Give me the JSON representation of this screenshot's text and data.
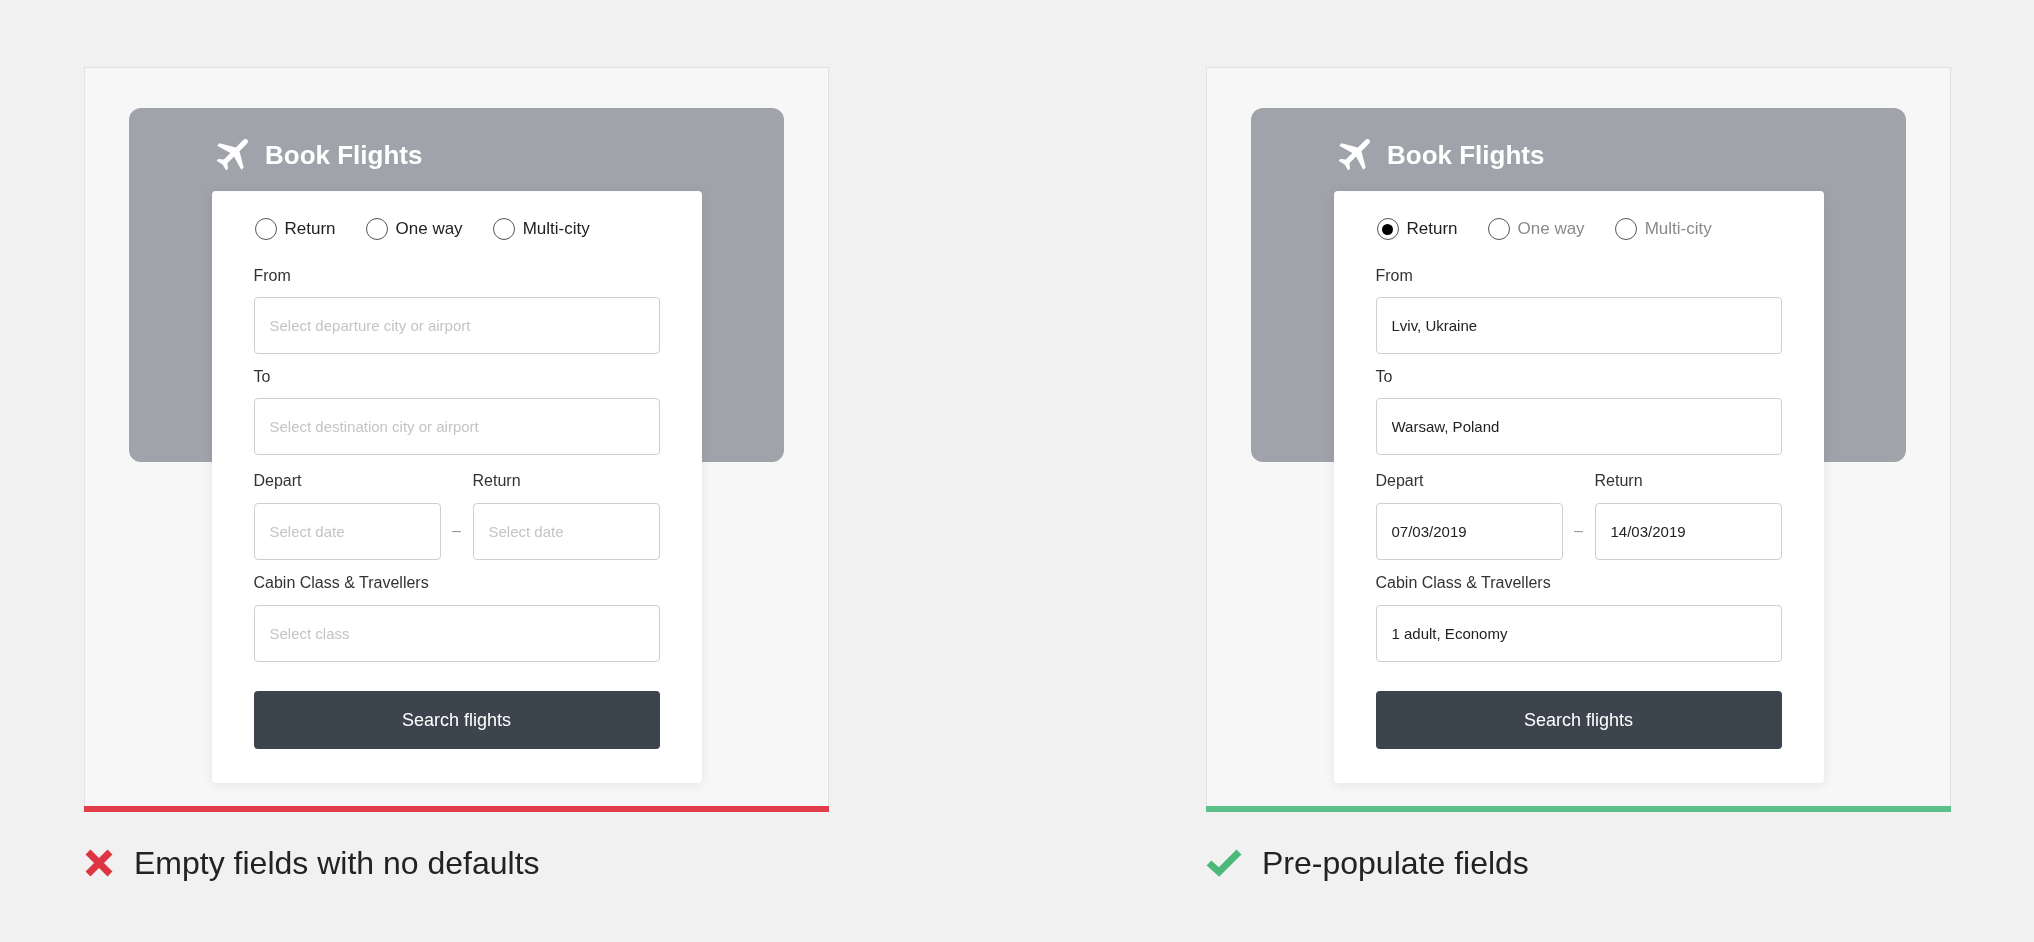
{
  "examples": [
    {
      "kind": "bad",
      "color": "#e03c4a",
      "caption": "Empty fields with no defaults",
      "form": {
        "title": "Book Flights",
        "trip_types": [
          {
            "label": "Return",
            "selected": false
          },
          {
            "label": "One way",
            "selected": false
          },
          {
            "label": "Multi-city",
            "selected": false
          }
        ],
        "from": {
          "label": "From",
          "placeholder": "Select departure city or airport"
        },
        "to": {
          "label": "To",
          "placeholder": "Select destination city or airport"
        },
        "dates": {
          "separator": "–",
          "depart": {
            "label": "Depart",
            "placeholder": "Select date"
          },
          "return": {
            "label": "Return",
            "placeholder": "Select date"
          }
        },
        "cabin": {
          "label": "Cabin Class & Travellers",
          "placeholder": "Select class"
        },
        "button": "Search flights"
      }
    },
    {
      "kind": "good",
      "color": "#5cc08a",
      "caption": "Pre-populate fields",
      "form": {
        "title": "Book Flights",
        "trip_types": [
          {
            "label": "Return",
            "selected": true
          },
          {
            "label": "One way",
            "selected": false
          },
          {
            "label": "Multi-city",
            "selected": false
          }
        ],
        "from": {
          "label": "From",
          "value": "Lviv, Ukraine"
        },
        "to": {
          "label": "To",
          "value": "Warsaw, Poland"
        },
        "dates": {
          "separator": "–",
          "depart": {
            "label": "Depart",
            "value": "07/03/2019"
          },
          "return": {
            "label": "Return",
            "value": "14/03/2019"
          }
        },
        "cabin": {
          "label": "Cabin Class & Travellers",
          "value": "1 adult, Economy"
        },
        "button": "Search flights"
      }
    }
  ]
}
